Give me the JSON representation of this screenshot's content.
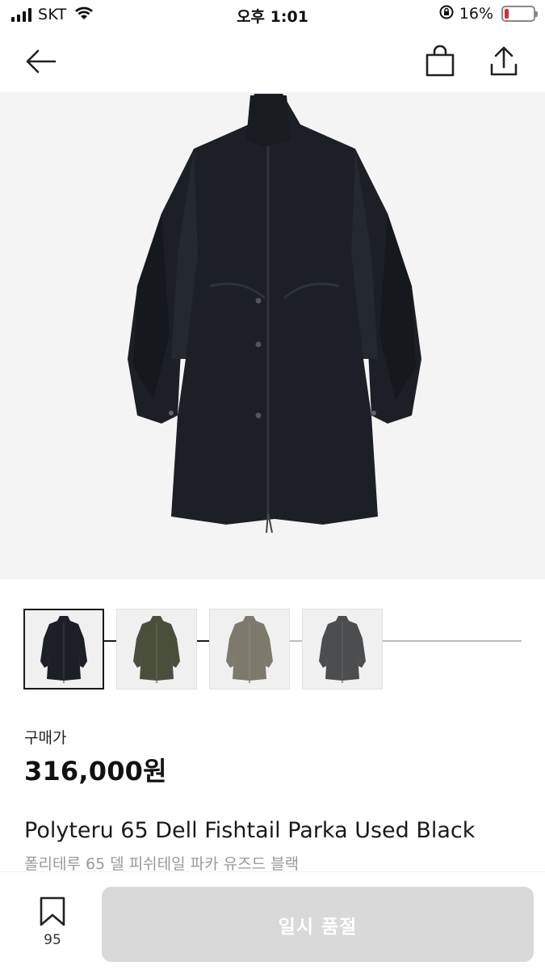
{
  "status_bar": {
    "carrier": "SKT",
    "time": "오후 1:01",
    "battery_percent": "16%",
    "battery_level": 0.16,
    "battery_color": "#e5252a"
  },
  "nav": {
    "back_icon": "arrow-left-icon",
    "bag_icon": "shopping-bag-icon",
    "share_icon": "share-icon"
  },
  "gallery": {
    "progress": 0.5,
    "thumbnails": [
      {
        "color": "#1c1f25",
        "selected": true
      },
      {
        "color": "#4a4f3c",
        "selected": false
      },
      {
        "color": "#7d7a6b",
        "selected": false
      },
      {
        "color": "#4c4d4f",
        "selected": false
      }
    ]
  },
  "product": {
    "price_label": "구매가",
    "price": "316,000원",
    "title_en": "Polyteru 65 Dell Fishtail Parka Used Black",
    "title_ko": "폴리테루 65 델 피쉬테일 파카 유즈드 블랙"
  },
  "bottom": {
    "bookmark_icon": "bookmark-icon",
    "bookmark_count": "95",
    "buy_label": "일시 품절"
  }
}
